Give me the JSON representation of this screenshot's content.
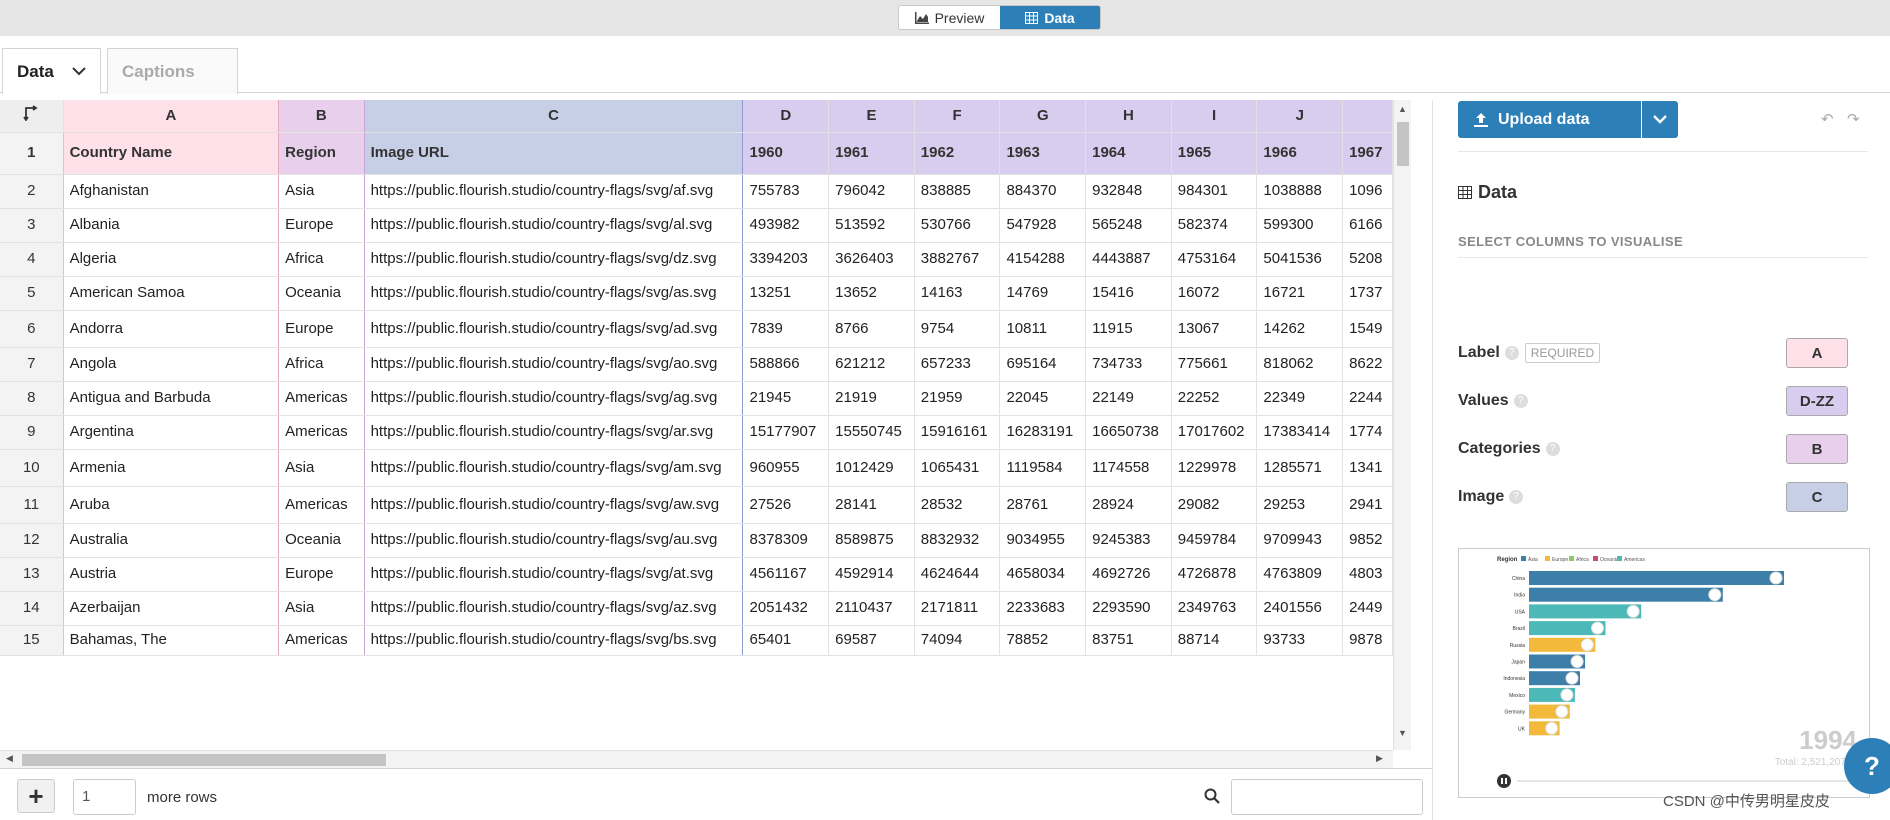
{
  "topbar": {
    "preview_label": "Preview",
    "data_label": "Data"
  },
  "tabs": [
    {
      "label": "Data"
    },
    {
      "label": "Captions"
    }
  ],
  "sheet": {
    "column_letters": [
      "A",
      "B",
      "C",
      "D",
      "E",
      "F",
      "G",
      "H",
      "I",
      "J",
      ""
    ],
    "header_row": [
      "Country Name",
      "Region",
      "Image URL",
      "1960",
      "1961",
      "1962",
      "1963",
      "1964",
      "1965",
      "1966",
      "1967"
    ],
    "rows": [
      [
        "2",
        "Afghanistan",
        "Asia",
        "https://public.flourish.studio/country-flags/svg/af.svg",
        "755783",
        "796042",
        "838885",
        "884370",
        "932848",
        "984301",
        "1038888",
        "1096"
      ],
      [
        "3",
        "Albania",
        "Europe",
        "https://public.flourish.studio/country-flags/svg/al.svg",
        "493982",
        "513592",
        "530766",
        "547928",
        "565248",
        "582374",
        "599300",
        "6166"
      ],
      [
        "4",
        "Algeria",
        "Africa",
        "https://public.flourish.studio/country-flags/svg/dz.svg",
        "3394203",
        "3626403",
        "3882767",
        "4154288",
        "4443887",
        "4753164",
        "5041536",
        "5208"
      ],
      [
        "5",
        "American Samoa",
        "Oceania",
        "https://public.flourish.studio/country-flags/svg/as.svg",
        "13251",
        "13652",
        "14163",
        "14769",
        "15416",
        "16072",
        "16721",
        "1737"
      ],
      [
        "6",
        "Andorra",
        "Europe",
        "https://public.flourish.studio/country-flags/svg/ad.svg",
        "7839",
        "8766",
        "9754",
        "10811",
        "11915",
        "13067",
        "14262",
        "1549"
      ],
      [
        "7",
        "Angola",
        "Africa",
        "https://public.flourish.studio/country-flags/svg/ao.svg",
        "588866",
        "621212",
        "657233",
        "695164",
        "734733",
        "775661",
        "818062",
        "8622"
      ],
      [
        "8",
        "Antigua and Barbuda",
        "Americas",
        "https://public.flourish.studio/country-flags/svg/ag.svg",
        "21945",
        "21919",
        "21959",
        "22045",
        "22149",
        "22252",
        "22349",
        "2244"
      ],
      [
        "9",
        "Argentina",
        "Americas",
        "https://public.flourish.studio/country-flags/svg/ar.svg",
        "15177907",
        "15550745",
        "15916161",
        "16283191",
        "16650738",
        "17017602",
        "17383414",
        "1774"
      ],
      [
        "10",
        "Armenia",
        "Asia",
        "https://public.flourish.studio/country-flags/svg/am.svg",
        "960955",
        "1012429",
        "1065431",
        "1119584",
        "1174558",
        "1229978",
        "1285571",
        "1341"
      ],
      [
        "11",
        "Aruba",
        "Americas",
        "https://public.flourish.studio/country-flags/svg/aw.svg",
        "27526",
        "28141",
        "28532",
        "28761",
        "28924",
        "29082",
        "29253",
        "2941"
      ],
      [
        "12",
        "Australia",
        "Oceania",
        "https://public.flourish.studio/country-flags/svg/au.svg",
        "8378309",
        "8589875",
        "8832932",
        "9034955",
        "9245383",
        "9459784",
        "9709943",
        "9852"
      ],
      [
        "13",
        "Austria",
        "Europe",
        "https://public.flourish.studio/country-flags/svg/at.svg",
        "4561167",
        "4592914",
        "4624644",
        "4658034",
        "4692726",
        "4726878",
        "4763809",
        "4803"
      ],
      [
        "14",
        "Azerbaijan",
        "Asia",
        "https://public.flourish.studio/country-flags/svg/az.svg",
        "2051432",
        "2110437",
        "2171811",
        "2233683",
        "2293590",
        "2349763",
        "2401556",
        "2449"
      ],
      [
        "15",
        "Bahamas, The",
        "Americas",
        "https://public.flourish.studio/country-flags/svg/bs.svg",
        "65401",
        "69587",
        "74094",
        "78852",
        "83751",
        "88714",
        "93733",
        "9878"
      ]
    ]
  },
  "bottom": {
    "rows_value": "1",
    "more_rows_label": "more rows"
  },
  "panel": {
    "upload_label": "Upload data",
    "data_title": "Data",
    "select_columns_label": "SELECT COLUMNS TO VISUALISE",
    "bindings": [
      {
        "label": "Label",
        "required": "REQUIRED",
        "value": "A",
        "color": "#fde0e8"
      },
      {
        "label": "Values",
        "required": "",
        "value": "D-ZZ",
        "color": "#d8cdee"
      },
      {
        "label": "Categories",
        "required": "",
        "value": "B",
        "color": "#e8d0ec"
      },
      {
        "label": "Image",
        "required": "",
        "value": "C",
        "color": "#c7cfe7"
      }
    ]
  },
  "preview": {
    "legend_title": "Region",
    "legend": [
      "Asia",
      "Europe",
      "Africa",
      "Oceania",
      "Americas"
    ],
    "year": "1994",
    "total": "Total: 2,521,207,...",
    "bars": [
      {
        "name": "China",
        "value": 1.0,
        "color": "#3d7fa8"
      },
      {
        "name": "India",
        "value": 0.76,
        "color": "#3d7fa8"
      },
      {
        "name": "USA",
        "value": 0.44,
        "color": "#4cb8b8"
      },
      {
        "name": "Brazil",
        "value": 0.3,
        "color": "#4cb8b8"
      },
      {
        "name": "Russia",
        "value": 0.26,
        "color": "#f2b93b"
      },
      {
        "name": "Japan",
        "value": 0.22,
        "color": "#3d7fa8"
      },
      {
        "name": "Indonesia",
        "value": 0.2,
        "color": "#3d7fa8"
      },
      {
        "name": "Mexico",
        "value": 0.18,
        "color": "#4cb8b8"
      },
      {
        "name": "Germany",
        "value": 0.16,
        "color": "#f2b93b"
      },
      {
        "name": "UK",
        "value": 0.12,
        "color": "#f2b93b"
      }
    ]
  },
  "watermark": "CSDN @中传男明星皮皮",
  "colors": {
    "accent": "#2d7fb8"
  }
}
